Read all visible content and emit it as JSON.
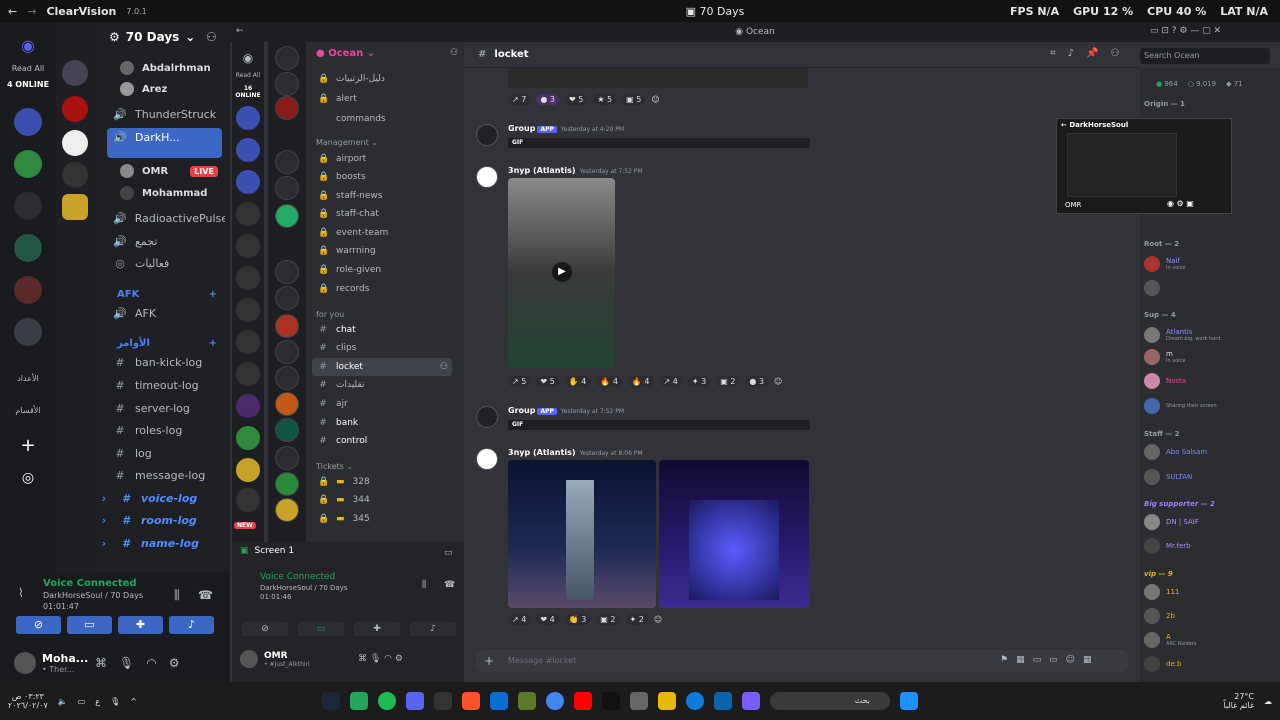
{
  "topbar": {
    "app_name": "ClearVision",
    "app_version": "7.0.1",
    "title": "70 Days",
    "fps_label": "FPS",
    "fps": "N/A",
    "gpu_label": "GPU",
    "gpu": "12 %",
    "cpu_label": "CPU",
    "cpu": "40 %",
    "lat_label": "LAT",
    "lat": "N/A"
  },
  "outer_rail": {
    "read_all": "Read All",
    "online": "4 ONLINE",
    "label_a": "الأعداد",
    "label_b": "الأقسام"
  },
  "outer_channels": {
    "server_name": "70 Days",
    "items": [
      {
        "label": "Abdalrhman"
      },
      {
        "label": "Arez"
      },
      {
        "label": "ThunderStruck"
      },
      {
        "label": "DarkH..."
      },
      {
        "label": "OMR"
      },
      {
        "label": "Mohammad"
      },
      {
        "label": "RadioactivePulse"
      },
      {
        "label": "تجمع"
      },
      {
        "label": "فعاليات"
      },
      {
        "label": "AFK"
      },
      {
        "label": "الأوامر"
      },
      {
        "label": "AFK"
      },
      {
        "label": "ban-kick-log"
      },
      {
        "label": "timeout-log"
      },
      {
        "label": "server-log"
      },
      {
        "label": "roles-log"
      },
      {
        "label": "log"
      },
      {
        "label": "message-log"
      },
      {
        "label": "voice-log"
      },
      {
        "label": "room-log"
      },
      {
        "label": "name-log"
      }
    ],
    "live_badge": "LIVE"
  },
  "outer_voice": {
    "status": "Voice Connected",
    "channel": "DarkHorseSoul / 70 Days",
    "time": "01:01:47",
    "user_name": "Moha...",
    "user_status": "• Ther..."
  },
  "inner": {
    "window_title": "Ocean",
    "read_all": "Read All",
    "online": "16 ONLINE",
    "server_name": "Ocean",
    "channels": [
      {
        "label": "دليل-الرتبيات"
      },
      {
        "label": "alert"
      },
      {
        "label": "commands"
      }
    ],
    "cat_management": "Management",
    "management": [
      {
        "label": "airport"
      },
      {
        "label": "boosts"
      },
      {
        "label": "staff-news"
      },
      {
        "label": "staff-chat"
      },
      {
        "label": "event-team"
      },
      {
        "label": "warrning"
      },
      {
        "label": "role-given"
      },
      {
        "label": "records"
      }
    ],
    "cat_for_you": "for you",
    "for_you": [
      {
        "label": "chat"
      },
      {
        "label": "clips"
      },
      {
        "label": "locket"
      },
      {
        "label": "تقليدات"
      },
      {
        "label": "ajr"
      },
      {
        "label": "bank"
      },
      {
        "label": "control"
      }
    ],
    "cat_tickets": "Tickets",
    "tickets": [
      {
        "label": "328"
      },
      {
        "label": "344"
      },
      {
        "label": "345"
      }
    ],
    "new_badge": "NEW",
    "screen_label": "Screen 1",
    "voice_status": "Voice Connected",
    "voice_channel": "DarkHorseSoul / 70 Days",
    "voice_time": "01:01:46",
    "user_name": "OMR",
    "user_status": "• #Just_Alkthiri"
  },
  "chat": {
    "channel": "locket",
    "search_placeholder": "Search Ocean",
    "input_placeholder": "Message #locket",
    "messages": [
      {
        "author": "Group",
        "tag": "APP",
        "time": "Yesterday at 4:29 PM",
        "gif": "GIF"
      },
      {
        "author": "3nyp (Atlantis)",
        "time": "Yesterday at 7:52 PM"
      },
      {
        "author": "Group",
        "tag": "APP",
        "time": "Yesterday at 7:52 PM",
        "gif": "GIF"
      },
      {
        "author": "3nyp (Atlantis)",
        "time": "Yesterday at 8:06 PM"
      }
    ],
    "reactions_1": [
      "7",
      "3",
      "5",
      "5",
      "5"
    ],
    "reactions_2": [
      "5",
      "5",
      "4",
      "4",
      "4",
      "4",
      "3",
      "2",
      "3"
    ],
    "reactions_3": [
      "4",
      "4",
      "3",
      "2",
      "2"
    ]
  },
  "members": {
    "stats": [
      "964",
      "9,019",
      "71"
    ],
    "stream_user": "DarkHorseSoul",
    "stream_viewer": "OMR",
    "cats": [
      {
        "label": "Origin — 1"
      },
      {
        "label": "Root — 2"
      },
      {
        "label": "Sup — 4"
      },
      {
        "label": "Staff — 2"
      },
      {
        "label": "Big supporter — 2"
      },
      {
        "label": "vip — 9"
      }
    ],
    "list": [
      {
        "name": "Naif",
        "status": "In voice"
      },
      {
        "name": "Atlantis",
        "status": "Dream big, work hard."
      },
      {
        "name": "m",
        "status": "In voice"
      },
      {
        "name": "Nosta",
        "status": ""
      },
      {
        "name": "",
        "status": "Sharing their screen"
      },
      {
        "name": "Abo Salsam",
        "status": ""
      },
      {
        "name": "SULTAN",
        "status": ""
      },
      {
        "name": "DN | SAIF",
        "status": ""
      },
      {
        "name": "Mr.ferb",
        "status": ""
      },
      {
        "name": "111",
        "status": ""
      },
      {
        "name": "2b",
        "status": ""
      },
      {
        "name": "A",
        "status": "ARC Raiders"
      },
      {
        "name": "de.b",
        "status": ""
      }
    ]
  },
  "taskbar": {
    "time": "٠٣:٢٣ ص",
    "date": "٢٠٢٦/٠٢/٠٧",
    "lang": "ع",
    "search": "بحث",
    "temp": "27°C",
    "weather": "غائم غالباً"
  },
  "colors": {
    "accent": "#5865f2",
    "green": "#23a55a",
    "blue_sel": "#3c67c4",
    "pink": "#eb459e"
  }
}
